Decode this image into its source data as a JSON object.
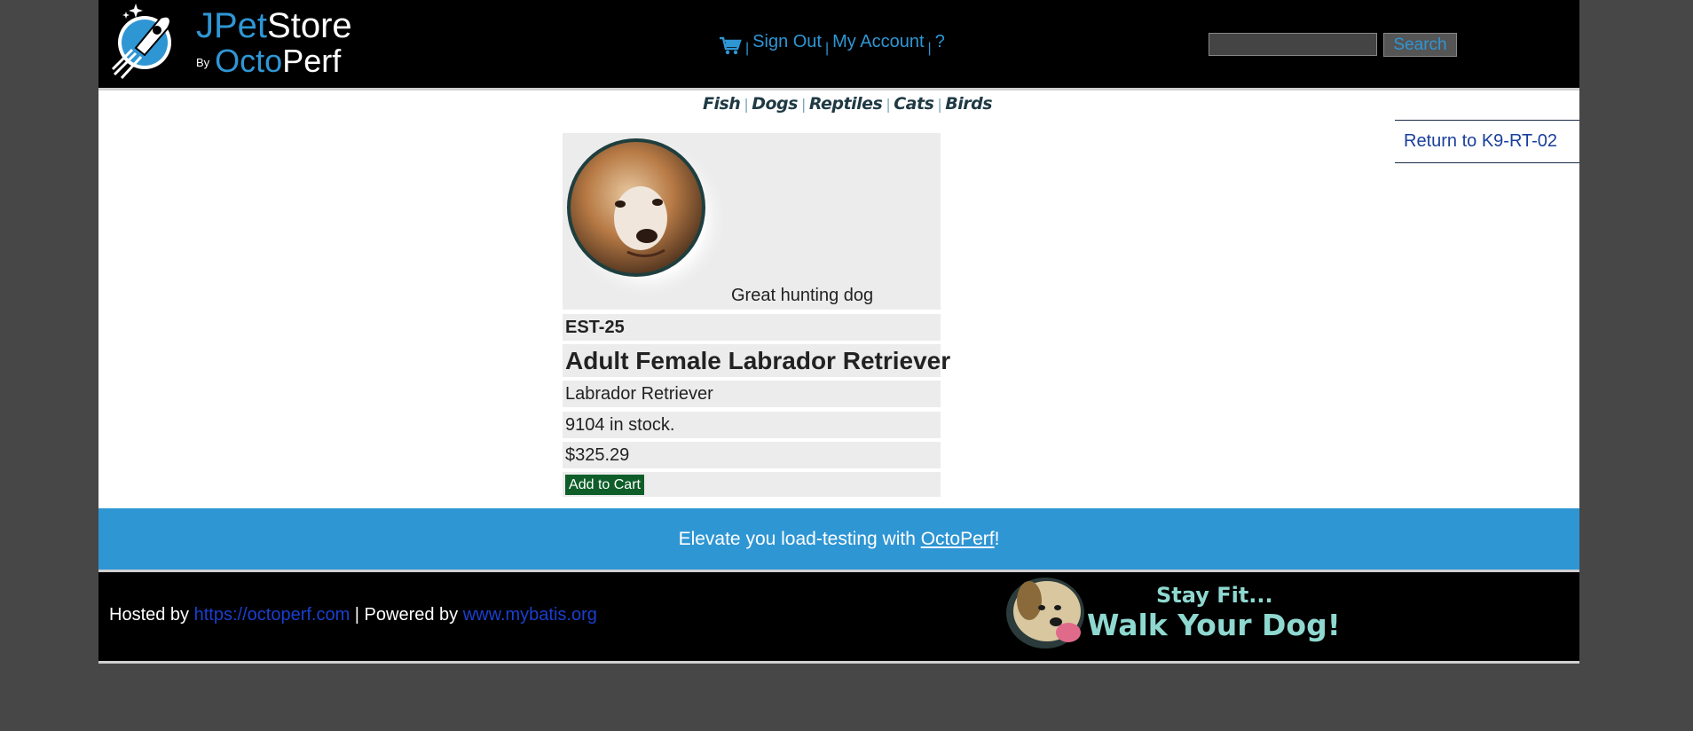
{
  "header": {
    "brand_part1": "JPet",
    "brand_part2": "Store",
    "brand_by": "By",
    "brand_part3": "Octo",
    "brand_part4": "Perf",
    "menu": {
      "sign_out": "Sign Out",
      "my_account": "My Account",
      "help": "?",
      "separator": "|"
    },
    "search": {
      "value": "",
      "button_label": "Search"
    }
  },
  "quicklinks": [
    "Fish",
    "Dogs",
    "Reptiles",
    "Cats",
    "Birds"
  ],
  "return_link": "Return to K9-RT-02",
  "item": {
    "description": "Great hunting dog",
    "id": "EST-25",
    "name": "Adult Female Labrador Retriever",
    "product": "Labrador Retriever",
    "stock": "9104 in stock.",
    "price": "$325.29",
    "add_to_cart": "Add to Cart"
  },
  "promo": {
    "prefix": "Elevate you load-testing with ",
    "link": "OctoPerf",
    "suffix": "!"
  },
  "footer": {
    "hosted_by": "Hosted by ",
    "hosted_link": "https://octoperf.com",
    "powered_by": " | Powered by ",
    "powered_link": "www.mybatis.org",
    "banner_line1": "Stay Fit...",
    "banner_line2": "Walk Your Dog!"
  },
  "colors": {
    "accent": "#2f96d4",
    "header_bg": "#000000",
    "page_bg": "#474747",
    "cart_button": "#0f5e2a",
    "banner_text": "#8ed8d0"
  }
}
